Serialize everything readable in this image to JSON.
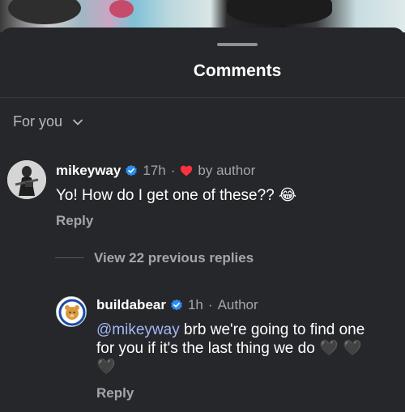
{
  "sheet": {
    "title": "Comments"
  },
  "filter": {
    "label": "For you",
    "icon": "chevron-down-icon"
  },
  "comments": [
    {
      "username": "mikeyway",
      "verified": true,
      "time": "17h",
      "separator": "·",
      "liked_by_author_text": "by author",
      "text": "Yo! How do I get one of these??",
      "emoji": "😂",
      "reply_label": "Reply"
    }
  ],
  "thread": {
    "view_replies_label": "View 22 previous replies"
  },
  "replies": [
    {
      "username": "buildabear",
      "verified": true,
      "time": "1h",
      "separator": "·",
      "badge": "Author",
      "mention": "@mikeyway",
      "text_line1": "brb we're going to find one",
      "text_line2": "for you if it's the last thing we do",
      "hearts": [
        "🖤",
        "🖤",
        "🖤"
      ],
      "reply_label": "Reply"
    }
  ],
  "colors": {
    "background": "#25272b",
    "verified": "#2d8cf0",
    "heart": "#ff3040",
    "muted_text": "#a4a6a9",
    "mention": "#a5b7f4"
  }
}
